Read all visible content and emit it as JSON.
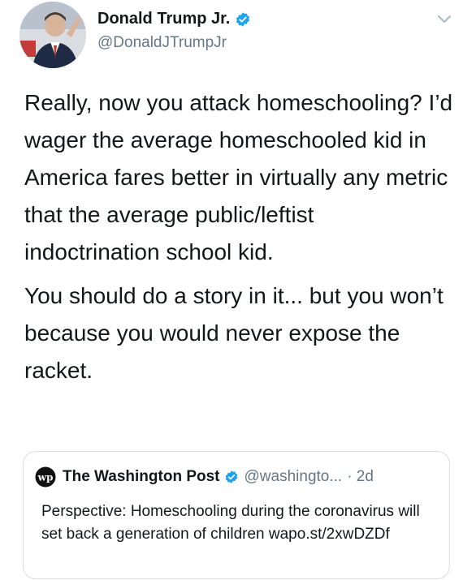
{
  "author": {
    "name": "Donald Trump Jr.",
    "handle": "@DonaldJTrumpJr",
    "verified": true
  },
  "tweet": {
    "paragraphs": [
      "Really, now you attack homeschooling? I’d wager the average homeschooled kid in America fares better in virtually any metric that the average public/leftist indoctrination school kid.",
      "You should do a story in it... but you won’t because you would never expose the racket."
    ]
  },
  "quoted_tweet": {
    "logo_text": "wp",
    "name": "The Washington Post",
    "verified": true,
    "handle": "@washingto...",
    "time": "· 2d",
    "text": "Perspective: Homeschooling during the coronavirus will set back a generation of children wapo.st/2xwDZDf"
  },
  "icons": {
    "avatar": "profile-photo",
    "verified": "verified-badge-icon",
    "menu": "chevron-down-icon",
    "quote_logo": "washington-post-logo"
  },
  "colors": {
    "verified_blue": "#1da1f2",
    "secondary_text": "#657786",
    "primary_text": "#14171a"
  }
}
